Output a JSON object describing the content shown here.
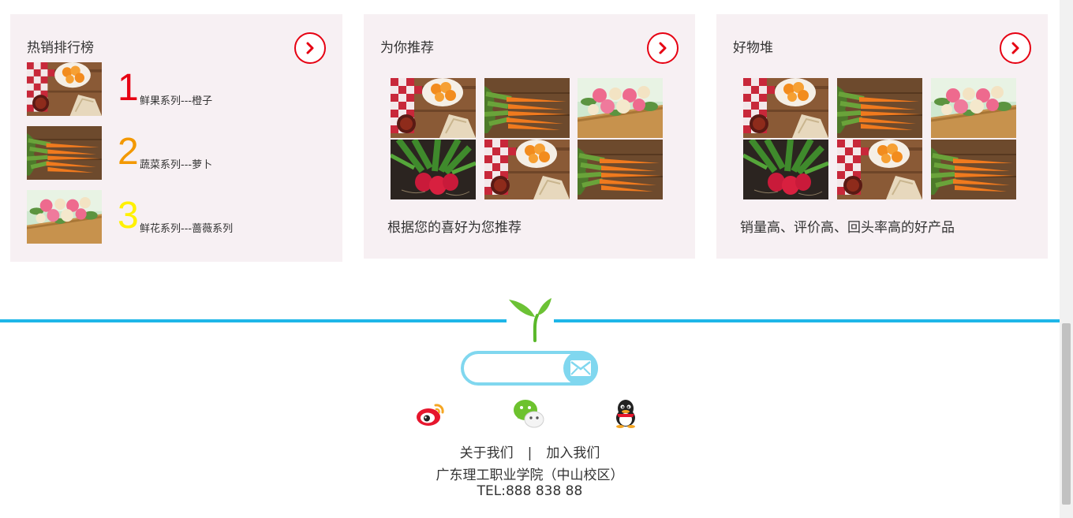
{
  "hot_ranking": {
    "title": "热销排行榜",
    "items": [
      {
        "rank": "1",
        "label": "鲜果系列---橙子",
        "image": "fruit-photo",
        "color": "#e60012"
      },
      {
        "rank": "2",
        "label": "蔬菜系列---萝卜",
        "image": "carrot-photo",
        "color": "#f39800"
      },
      {
        "rank": "3",
        "label": "鲜花系列---蔷薇系列",
        "image": "rose-photo",
        "color": "#fff100"
      }
    ]
  },
  "recommend": {
    "title": "为你推荐",
    "images": [
      "fruit-photo",
      "carrot-photo",
      "rose-photo",
      "radish-photo",
      "fruit-photo",
      "carrot-photo"
    ],
    "description": "根据您的喜好为您推荐"
  },
  "good_stuff": {
    "title": "好物堆",
    "images": [
      "fruit-photo",
      "carrot-photo",
      "rose-photo",
      "radish-photo",
      "fruit-photo",
      "carrot-photo"
    ],
    "description": "销量高、评价高、回头率高的好产品"
  },
  "footer": {
    "subscribe_placeholder": "",
    "social": [
      "weibo-icon",
      "wechat-icon",
      "qq-icon"
    ],
    "about_link": "关于我们",
    "separator": "|",
    "join_link": "加入我们",
    "school": "广东理工职业学院（中山校区）",
    "tel": "TEL:888 838 88"
  },
  "colors": {
    "accent_red": "#e60012",
    "divider_blue": "#1eb6e8",
    "subscribe_border": "#80d7ef",
    "panel_bg": "#f7f0f3"
  }
}
